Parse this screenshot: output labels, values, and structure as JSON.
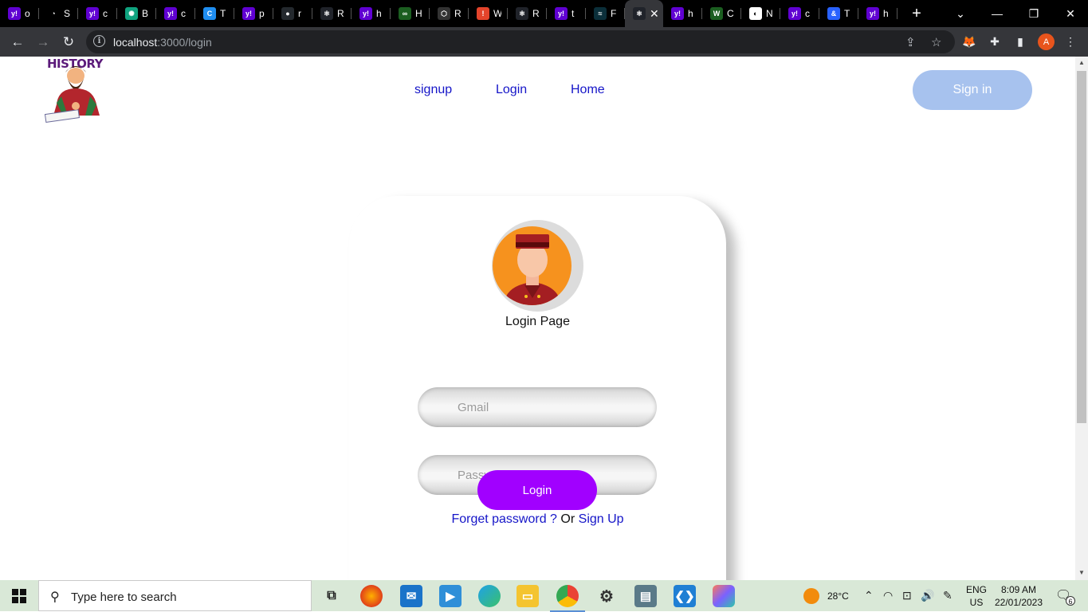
{
  "browser": {
    "tabs": [
      {
        "icon": "yahoo-icon",
        "color": "#6001d2",
        "glyph": "y!",
        "title": "o"
      },
      {
        "icon": "speedometer-icon",
        "color": "#000000",
        "glyph": "◔",
        "title": "S"
      },
      {
        "icon": "yahoo-icon",
        "color": "#6001d2",
        "glyph": "y!",
        "title": "c"
      },
      {
        "icon": "chatgpt-icon",
        "color": "#10a37f",
        "glyph": "✺",
        "title": "B"
      },
      {
        "icon": "yahoo-icon",
        "color": "#6001d2",
        "glyph": "y!",
        "title": "c"
      },
      {
        "icon": "c-icon",
        "color": "#1f8ef1",
        "glyph": "C",
        "title": "T"
      },
      {
        "icon": "yahoo-icon",
        "color": "#6001d2",
        "glyph": "y!",
        "title": "p"
      },
      {
        "icon": "github-icon",
        "color": "#24292e",
        "glyph": "●",
        "title": "r"
      },
      {
        "icon": "react-icon",
        "color": "#20232a",
        "glyph": "⚛",
        "title": "R"
      },
      {
        "icon": "yahoo-icon",
        "color": "#6001d2",
        "glyph": "y!",
        "title": "h"
      },
      {
        "icon": "infinity-icon",
        "color": "#1b5e20",
        "glyph": "∞",
        "title": "H"
      },
      {
        "icon": "hex-icon",
        "color": "#333333",
        "glyph": "⬡",
        "title": "R"
      },
      {
        "icon": "alert-icon",
        "color": "#e4442b",
        "glyph": "!",
        "title": "W"
      },
      {
        "icon": "react-icon",
        "color": "#20232a",
        "glyph": "⚛",
        "title": "R"
      },
      {
        "icon": "yahoo-icon",
        "color": "#6001d2",
        "glyph": "y!",
        "title": "t"
      },
      {
        "icon": "tailwind-icon",
        "color": "#0b2f3a",
        "glyph": "≈",
        "title": "F"
      },
      {
        "icon": "react-icon",
        "color": "#20232a",
        "glyph": "⚛",
        "title": "",
        "active": true
      },
      {
        "icon": "yahoo-icon",
        "color": "#6001d2",
        "glyph": "y!",
        "title": "h"
      },
      {
        "icon": "w-icon",
        "color": "#1b5e20",
        "glyph": "W",
        "title": "C"
      },
      {
        "icon": "notion-icon",
        "color": "#ffffff",
        "glyph": "◐",
        "title": "N"
      },
      {
        "icon": "yahoo-icon",
        "color": "#6001d2",
        "glyph": "y!",
        "title": "c"
      },
      {
        "icon": "link-icon",
        "color": "#2962ff",
        "glyph": "&",
        "title": "T"
      },
      {
        "icon": "yahoo-icon",
        "color": "#6001d2",
        "glyph": "y!",
        "title": "h"
      }
    ],
    "address": {
      "host": "localhost",
      "path": ":3000/login"
    }
  },
  "page": {
    "logo_text": "HISTORY",
    "nav": {
      "signup": "signup",
      "login": "Login",
      "home": "Home"
    },
    "signin_label": "Sign in",
    "card": {
      "title": "Login Page",
      "gmail_placeholder": "Gmail",
      "password_placeholder": "Password",
      "login_label": "Login",
      "forget_label": "Forget password ?",
      "or_label": "Or",
      "signup_label": "Sign Up"
    }
  },
  "taskbar": {
    "search_placeholder": "Type here to search",
    "weather": "28°C",
    "lang": "ENG",
    "region": "US",
    "time": "8:09 AM",
    "date": "22/01/2023",
    "notifications": "6"
  }
}
